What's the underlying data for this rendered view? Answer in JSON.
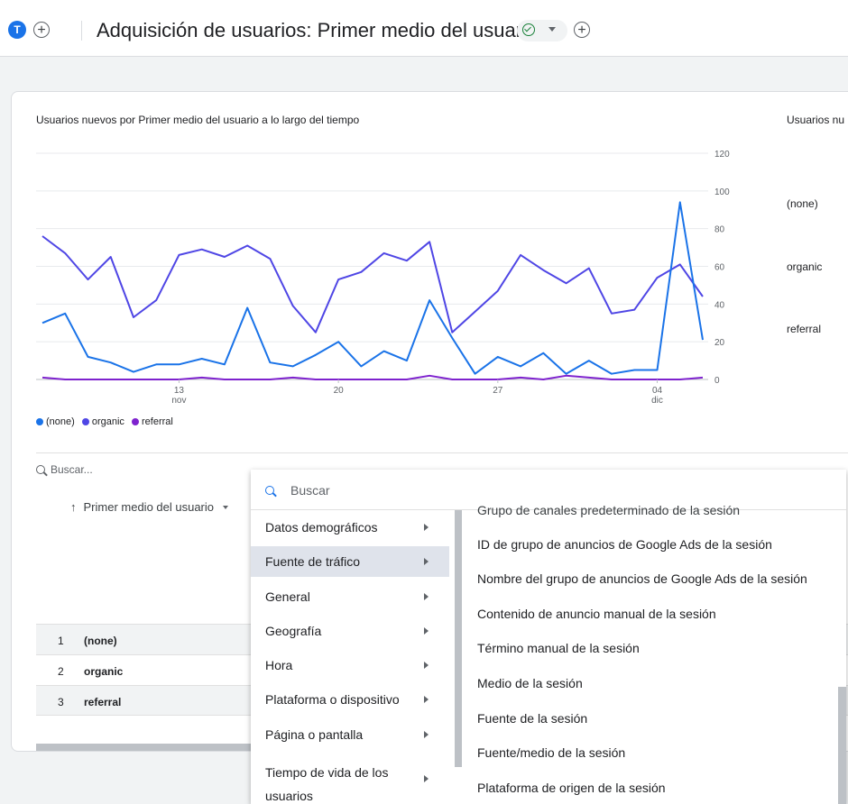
{
  "header": {
    "avatar_letter": "T",
    "add_symbol": "+",
    "title": "Adquisición de usuarios: Primer medio del usuario",
    "add_comparison_symbol": "+"
  },
  "chart": {
    "title": "Usuarios nuevos por Primer medio del usuario a lo largo del tiempo",
    "side_title": "Usuarios nu",
    "side_labels": [
      "(none)",
      "organic",
      "referral"
    ],
    "legend": [
      {
        "label": "(none)",
        "color": "#1a73e8"
      },
      {
        "label": "organic",
        "color": "#4f46e5"
      },
      {
        "label": "referral",
        "color": "#7e22ce"
      }
    ]
  },
  "chart_data": {
    "type": "line",
    "title": "Usuarios nuevos por Primer medio del usuario a lo largo del tiempo",
    "x": [
      "1",
      "2",
      "3",
      "4",
      "5",
      "6",
      "7",
      "8",
      "9",
      "10",
      "11",
      "12",
      "13",
      "14",
      "15",
      "16",
      "17",
      "18",
      "19",
      "20",
      "21",
      "22",
      "23",
      "24",
      "25",
      "26",
      "27",
      "28",
      "29",
      "30",
      "31",
      "32"
    ],
    "x_tick_labels": [
      {
        "index": 6,
        "label": "13",
        "sub": "nov"
      },
      {
        "index": 13,
        "label": "20",
        "sub": ""
      },
      {
        "index": 20,
        "label": "27",
        "sub": ""
      },
      {
        "index": 27,
        "label": "04",
        "sub": "dic"
      }
    ],
    "y_ticks": [
      0,
      20,
      40,
      60,
      80,
      100,
      120
    ],
    "ylim": [
      0,
      120
    ],
    "grid": true,
    "series": [
      {
        "name": "organic",
        "color": "#4f46e5",
        "values": [
          76,
          67,
          53,
          65,
          33,
          42,
          66,
          69,
          65,
          71,
          64,
          39,
          25,
          53,
          57,
          67,
          63,
          73,
          25,
          36,
          47,
          66,
          58,
          51,
          59,
          35,
          37,
          54,
          61,
          44
        ]
      },
      {
        "name": "(none)",
        "color": "#1a73e8",
        "values": [
          30,
          35,
          12,
          9,
          4,
          8,
          8,
          11,
          8,
          38,
          9,
          7,
          13,
          20,
          7,
          15,
          10,
          42,
          22,
          3,
          12,
          7,
          14,
          3,
          10,
          3,
          5,
          5,
          94,
          21
        ]
      },
      {
        "name": "referral",
        "color": "#7e22ce",
        "values": [
          1,
          0,
          0,
          0,
          0,
          0,
          0,
          1,
          0,
          0,
          0,
          1,
          0,
          0,
          0,
          0,
          0,
          2,
          0,
          0,
          0,
          1,
          0,
          2,
          1,
          0,
          0,
          0,
          0,
          1
        ]
      }
    ]
  },
  "table": {
    "search_placeholder": "Buscar...",
    "dimension_header": "Primer medio del usuario",
    "sort_arrow": "↑",
    "rows": [
      {
        "num": "1",
        "label": "(none)"
      },
      {
        "num": "2",
        "label": "organic"
      },
      {
        "num": "3",
        "label": "referral"
      }
    ]
  },
  "menu": {
    "search_placeholder": "Buscar",
    "categories": [
      "Datos demográficos",
      "Fuente de tráfico",
      "General",
      "Geografía",
      "Hora",
      "Plataforma o dispositivo",
      "Página o pantalla",
      "Tiempo de vida de los usuarios"
    ],
    "active_category": "Fuente de tráfico",
    "clipped_item": "Grupo de canales predeterminado de la sesión",
    "subitems": [
      "ID de grupo de anuncios de Google Ads de la sesión",
      "Nombre del grupo de anuncios de Google Ads de la sesión",
      "Contenido de anuncio manual de la sesión",
      "Término manual de la sesión",
      "Medio de la sesión",
      "Fuente de la sesión",
      "Fuente/medio de la sesión",
      "Plataforma de origen de la sesión"
    ]
  }
}
